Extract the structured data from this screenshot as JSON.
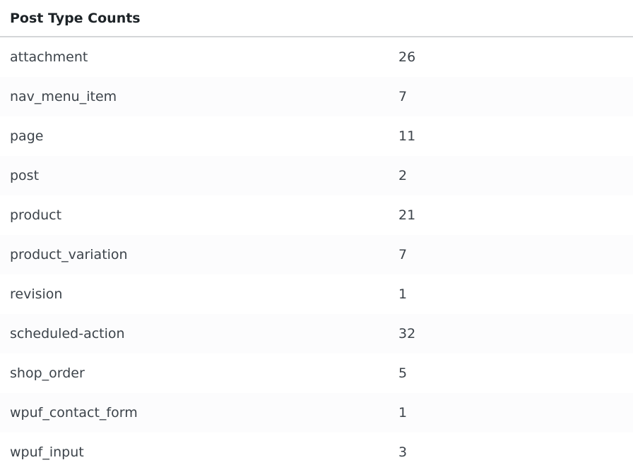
{
  "table": {
    "title": "Post Type Counts",
    "rows": [
      {
        "name": "attachment",
        "count": "26"
      },
      {
        "name": "nav_menu_item",
        "count": "7"
      },
      {
        "name": "page",
        "count": "11"
      },
      {
        "name": "post",
        "count": "2"
      },
      {
        "name": "product",
        "count": "21"
      },
      {
        "name": "product_variation",
        "count": "7"
      },
      {
        "name": "revision",
        "count": "1"
      },
      {
        "name": "scheduled-action",
        "count": "32"
      },
      {
        "name": "shop_order",
        "count": "5"
      },
      {
        "name": "wpuf_contact_form",
        "count": "1"
      },
      {
        "name": "wpuf_input",
        "count": "3"
      }
    ]
  }
}
